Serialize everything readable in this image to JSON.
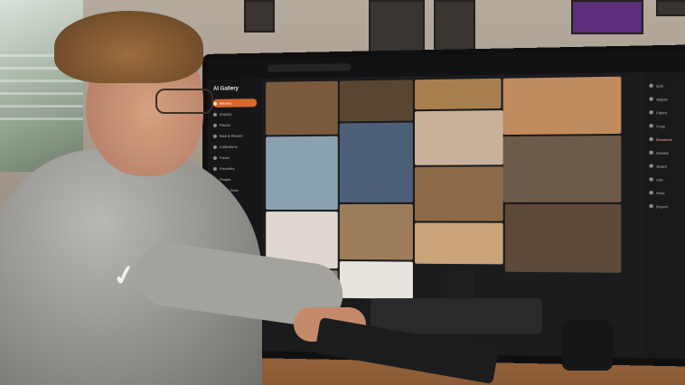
{
  "photo": {
    "monitor_app": {
      "sidebar": {
        "title": "AI Gallery",
        "items": [
          {
            "label": "Albums",
            "active": true
          },
          {
            "label": "Explore",
            "active": false
          },
          {
            "label": "Places",
            "active": false
          },
          {
            "label": "New & Recent",
            "active": false
          },
          {
            "label": "Collections",
            "active": false
          },
          {
            "label": "Faces",
            "active": false
          },
          {
            "label": "Favorites",
            "active": false
          },
          {
            "label": "People",
            "active": false
          },
          {
            "label": "Cloud Drive",
            "active": false
          },
          {
            "label": "Memories",
            "active": false
          },
          {
            "label": "Trash",
            "active": false
          },
          {
            "label": "Settings",
            "active": false
          },
          {
            "label": "Tasks",
            "active": false
          }
        ]
      },
      "right_panel": {
        "items": [
          {
            "label": "Edit"
          },
          {
            "label": "Adjust"
          },
          {
            "label": "Filters"
          },
          {
            "label": "Crop"
          },
          {
            "label": "Enhance",
            "highlight": true
          },
          {
            "label": "Details"
          },
          {
            "label": "Share"
          },
          {
            "label": "Info"
          },
          {
            "label": "Print"
          },
          {
            "label": "Export"
          }
        ]
      },
      "tile_colors": [
        "#7b5a3d",
        "#5a4630",
        "#a8804e",
        "#c08b5d",
        "#8aa1b2",
        "#4c5f76",
        "#c7b19b",
        "#6b5b48",
        "#ded8d1",
        "#9c7c5a",
        "#8d6b4a",
        "#5e4a38",
        "#c9a37a",
        "#8a7f74",
        "#e8e3dc"
      ]
    }
  }
}
